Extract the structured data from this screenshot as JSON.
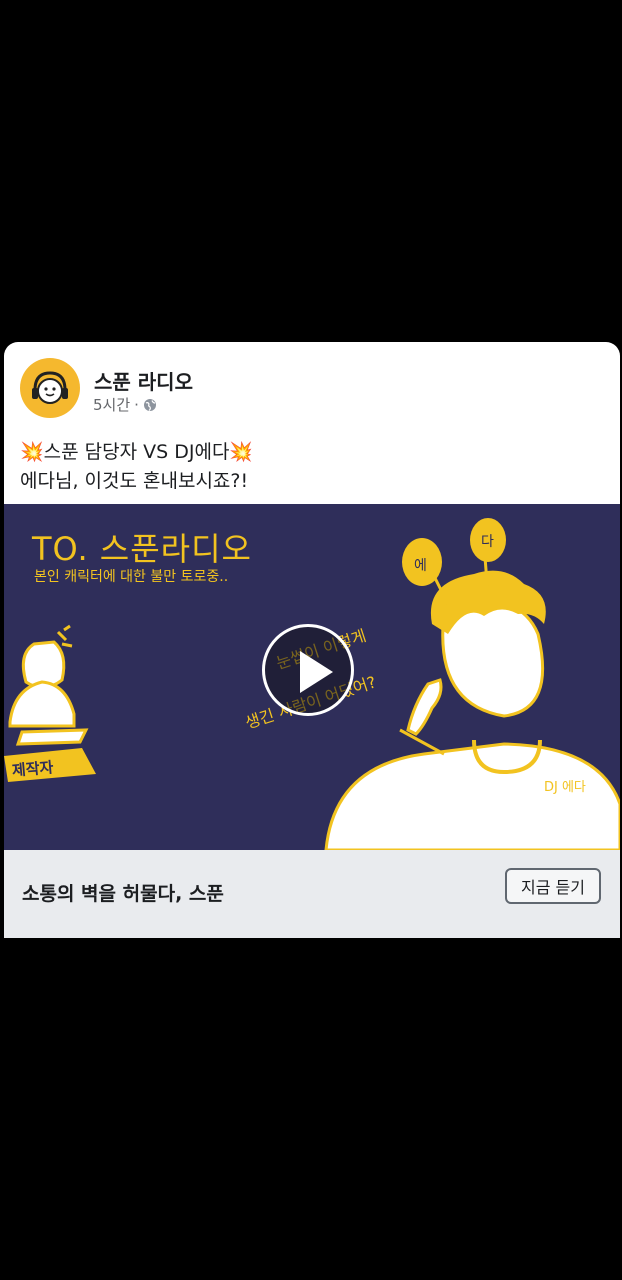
{
  "post": {
    "page_name": "스푼 라디오",
    "time": "5시간",
    "separator": "·",
    "audience_icon": "globe-icon",
    "text": "💥스푼 담당자 VS DJ에다💥\n에다님, 이것도 혼내보시죠?!"
  },
  "media": {
    "title": "TO. 스푼라디오",
    "subtitle": "본인 캐릭터에 대한 불만 토로중..",
    "balloon_left": "에",
    "balloon_right": "다",
    "speech_line1": "눈썹이 이렇게",
    "speech_line2": "생긴 사람이 어딨어?",
    "producer_label": "제작자",
    "dj_label": "DJ 에다",
    "play_icon": "play-icon"
  },
  "link": {
    "headline": "소통의 벽을 허물다, 스푼",
    "cta": "지금 듣기"
  },
  "colors": {
    "accent": "#f2c320",
    "media_bg": "#2f2e5a",
    "avatar_bg": "#f5b82e"
  }
}
